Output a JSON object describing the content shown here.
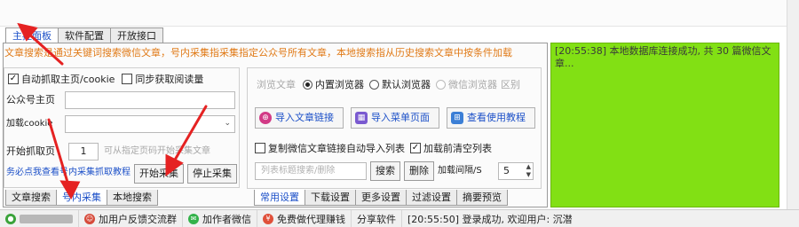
{
  "tabs_top": [
    "主控面板",
    "软件配置",
    "开放接口"
  ],
  "banner": "文章搜索是通过关键词搜索微信文章，号内采集指采集指定公众号所有文章，本地搜索指从历史搜索文章中按条件加载",
  "left": {
    "auto_capture": "自动抓取主页/cookie",
    "sync_read": "同步获取阅读量",
    "home_label": "公众号主页",
    "cookie_label": "加载cookie",
    "start_label": "开始抓取页",
    "start_value": "1",
    "start_hint": "可从指定页码开始采集文章",
    "tutorial_link": "务必点我查看号内采集抓取教程",
    "start_btn": "开始采集",
    "stop_btn": "停止采集"
  },
  "tabs_left_bottom": [
    "文章搜索",
    "号内采集",
    "本地搜索"
  ],
  "right": {
    "browse_label": "浏览文章",
    "opt_builtin": "内置浏览器",
    "opt_default": "默认浏览器",
    "opt_wechat": "微信浏览器",
    "opt_wechat_suffix": "区别",
    "import_article": "导入文章链接",
    "import_menu": "导入菜单页面",
    "view_tutorial": "查看使用教程",
    "copy_links": "复制微信文章链接自动导入列表",
    "clear_list": "加载前清空列表",
    "filter_placeholder": "列表标题搜索/删除",
    "search_btn": "搜索",
    "delete_btn": "删除",
    "interval_label": "加载间隔/S",
    "interval_value": "5"
  },
  "tabs_right_bottom": [
    "常用设置",
    "下载设置",
    "更多设置",
    "过滤设置",
    "摘要预览"
  ],
  "log": "[20:55:38] 本地数据库连接成功, 共 30 篇微信文章...",
  "status": {
    "feedback": "加用户反馈交流群",
    "author": "加作者微信",
    "agent": "免费做代理赚钱",
    "share": "分享软件",
    "message": "[20:55:50] 登录成功, 欢迎用户: 沉潜"
  }
}
